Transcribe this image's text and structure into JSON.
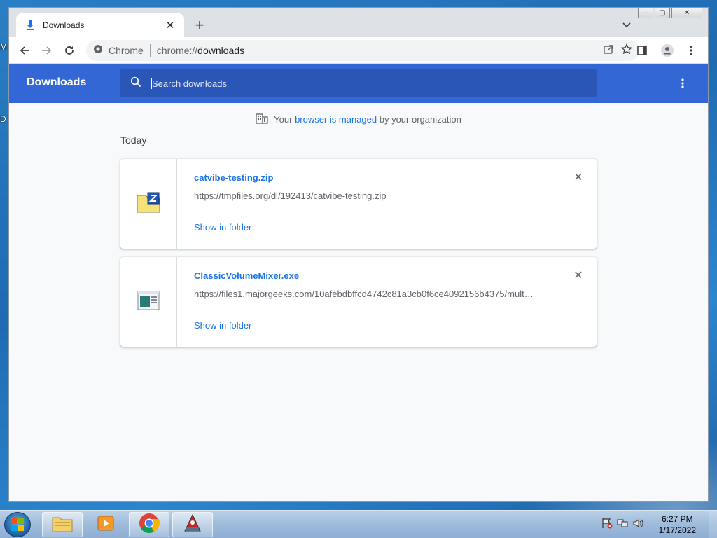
{
  "desktop": {
    "edge_label_1": "M",
    "edge_label_2": "D"
  },
  "window": {
    "tab": {
      "title": "Downloads",
      "icon": "download-icon"
    },
    "omnibox": {
      "site_label": "Chrome",
      "url_scheme": "chrome://",
      "url_host": "downloads"
    }
  },
  "page": {
    "title": "Downloads",
    "search_placeholder": "Search downloads",
    "managed": {
      "prefix": "Your ",
      "link": "browser is managed",
      "suffix": " by your organization"
    },
    "section_label": "Today",
    "downloads": [
      {
        "name": "catvibe-testing.zip",
        "url": "https://tmpfiles.org/dl/192413/catvibe-testing.zip",
        "action": "Show in folder",
        "icon": "zip-file-icon"
      },
      {
        "name": "ClassicVolumeMixer.exe",
        "url": "https://files1.majorgeeks.com/10afebdbffcd4742c81a3cb0f6ce4092156b4375/mult…",
        "action": "Show in folder",
        "icon": "exe-file-icon"
      }
    ]
  },
  "taskbar": {
    "apps": [
      "explorer-icon",
      "media-player-icon",
      "chrome-icon",
      "java-icon"
    ],
    "time": "6:27 PM",
    "date": "1/17/2022"
  }
}
